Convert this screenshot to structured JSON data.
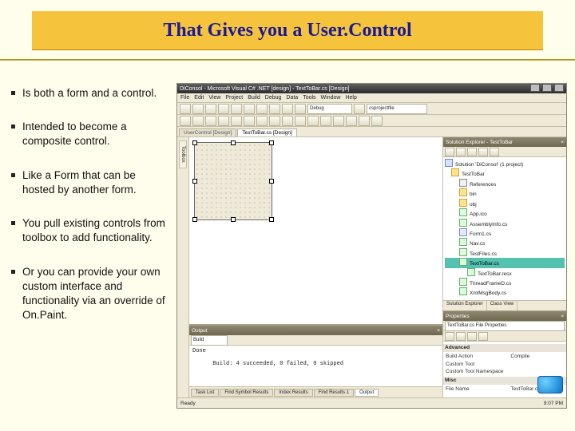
{
  "slide": {
    "title": "That Gives you a User.Control",
    "bullets": [
      "Is both a form and a control.",
      "Intended to become a composite control.",
      "Like a Form that can be hosted by another form.",
      "You pull existing controls from toolbox to add functionality.",
      "Or you can provide your own custom interface and functionality via an override of On.Paint."
    ]
  },
  "vs": {
    "title": "DiConsol - Microsoft Visual C# .NET [design] - TextToBar.cs [Design]",
    "menu": [
      "File",
      "Edit",
      "View",
      "Project",
      "Build",
      "Debug",
      "Data",
      "Tools",
      "Window",
      "Help"
    ],
    "toolbar": {
      "config": "Debug",
      "platform": "csprojectfile"
    },
    "doc_tabs": [
      {
        "label": "UserControl [Design]",
        "active": false
      },
      {
        "label": "TextToBar.cs [Design]",
        "active": true
      }
    ],
    "left_tabs": [
      "Toolbox"
    ],
    "solution_explorer": {
      "title": "Solution Explorer - TestToBar",
      "items": [
        {
          "depth": 0,
          "icon": "sln",
          "label": "Solution 'DiConsol' (1 project)"
        },
        {
          "depth": 1,
          "icon": "fld",
          "label": "TestToBar"
        },
        {
          "depth": 2,
          "icon": "ref",
          "label": "References"
        },
        {
          "depth": 2,
          "icon": "fld",
          "label": "bin"
        },
        {
          "depth": 2,
          "icon": "fld",
          "label": "obj"
        },
        {
          "depth": 2,
          "icon": "cs",
          "label": "App.ico"
        },
        {
          "depth": 2,
          "icon": "cs",
          "label": "AssemblyInfo.cs"
        },
        {
          "depth": 2,
          "icon": "frm",
          "label": "Form1.cs"
        },
        {
          "depth": 2,
          "icon": "cs",
          "label": "Nav.cs"
        },
        {
          "depth": 2,
          "icon": "cs",
          "label": "TestFiles.cs"
        },
        {
          "depth": 2,
          "icon": "cs",
          "label": "TextToBar.cs",
          "selected": true
        },
        {
          "depth": 3,
          "icon": "cs",
          "label": "TextToBar.resx"
        },
        {
          "depth": 2,
          "icon": "cs",
          "label": "ThreadFrameD.cs"
        },
        {
          "depth": 2,
          "icon": "cs",
          "label": "XmlMsgBody.cs"
        }
      ],
      "bottom_tabs": [
        "Solution Explorer",
        "Class View"
      ]
    },
    "properties": {
      "title": "Properties",
      "subject": "TextToBar.cs  File Properties",
      "rows": [
        {
          "cat": true,
          "label": "Advanced"
        },
        {
          "label": "Build Action",
          "value": "Compile"
        },
        {
          "label": "Custom Tool",
          "value": ""
        },
        {
          "label": "Custom Tool Namespace",
          "value": ""
        },
        {
          "cat": true,
          "label": "Misc"
        },
        {
          "label": "File Name",
          "value": "TextToBar.cs"
        }
      ]
    },
    "output": {
      "title": "Output",
      "dropdown": "Build",
      "body": "Done\n\n      Build: 4 succeeded, 0 failed, 0 skipped",
      "bottom_tabs": [
        "Task List",
        "Find Symbol Results",
        "Index Results",
        "Find Results 1",
        "Output"
      ],
      "active_bottom_tab": "Output"
    },
    "status": {
      "left": "Ready",
      "right": "9:07 PM"
    }
  }
}
